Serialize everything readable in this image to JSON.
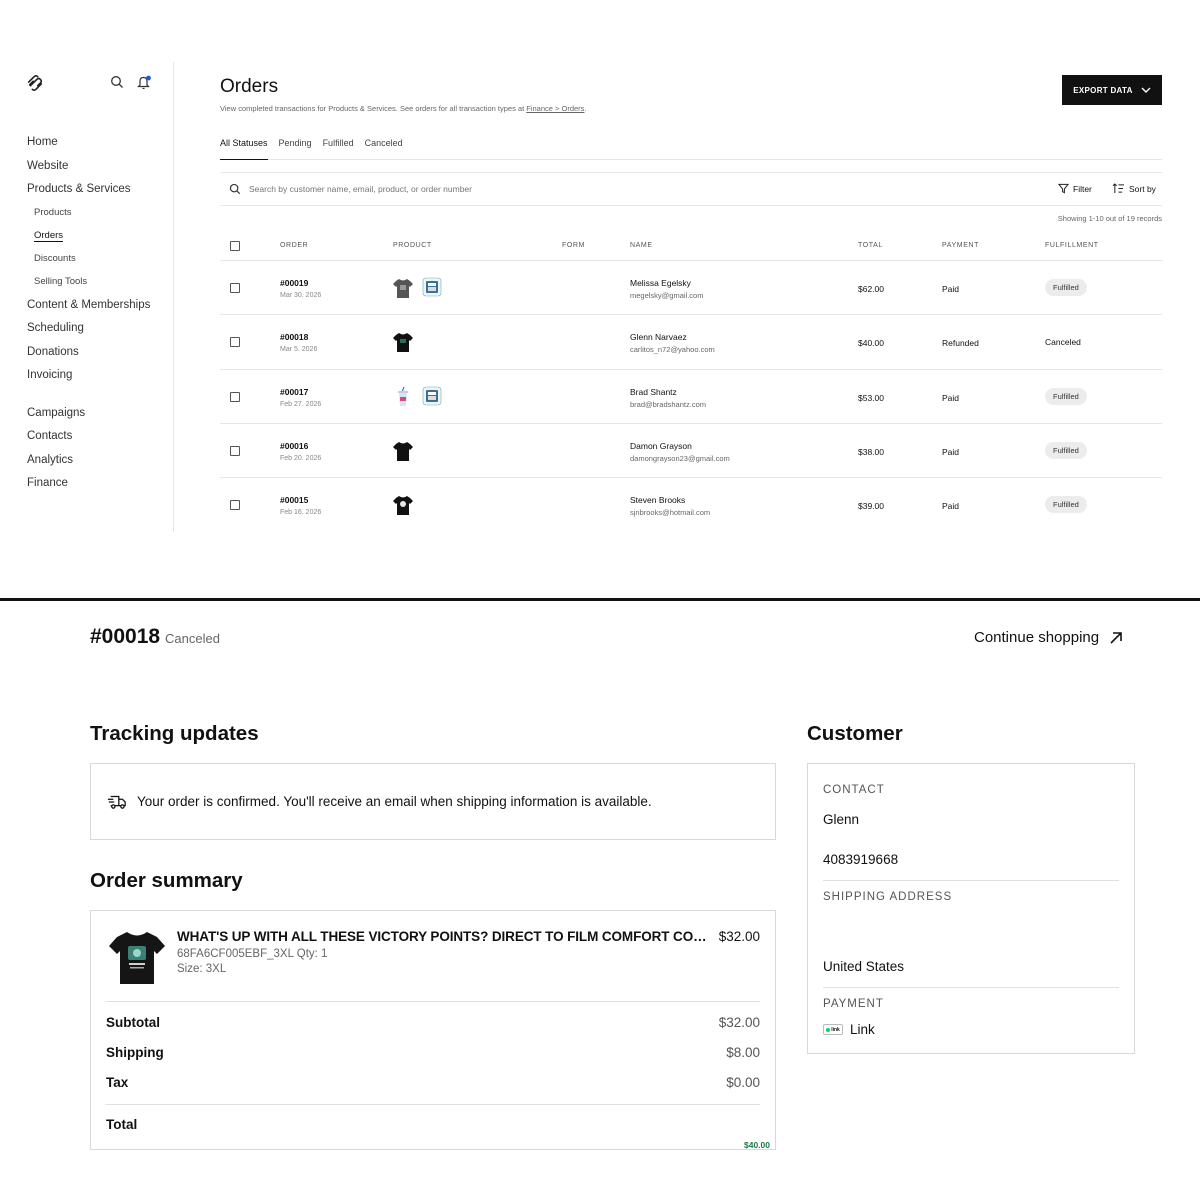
{
  "sidebar": {
    "nav": [
      {
        "label": "Home",
        "level": 1
      },
      {
        "label": "Website",
        "level": 1
      },
      {
        "label": "Products & Services",
        "level": 1
      },
      {
        "label": "Products",
        "level": 2
      },
      {
        "label": "Orders",
        "level": 2,
        "active": true
      },
      {
        "label": "Discounts",
        "level": 2
      },
      {
        "label": "Selling Tools",
        "level": 2
      },
      {
        "label": "Content & Memberships",
        "level": 1
      },
      {
        "label": "Scheduling",
        "level": 1
      },
      {
        "label": "Donations",
        "level": 1
      },
      {
        "label": "Invoicing",
        "level": 1
      },
      {
        "label": "Campaigns",
        "level": 1,
        "gap": true
      },
      {
        "label": "Contacts",
        "level": 1
      },
      {
        "label": "Analytics",
        "level": 1
      },
      {
        "label": "Finance",
        "level": 1
      }
    ]
  },
  "orders_page": {
    "title": "Orders",
    "description": "View completed transactions for Products & Services. See orders for all transaction types at ",
    "description_link": "Finance > Orders",
    "description_end": ".",
    "export_label": "EXPORT DATA",
    "tabs": [
      "All Statuses",
      "Pending",
      "Fulfilled",
      "Canceled"
    ],
    "active_tab": "All Statuses",
    "search_placeholder": "Search by customer name, email, product, or order number",
    "filter_label": "Filter",
    "sort_label": "Sort by",
    "records_text": "Showing 1-10 out of 19 records",
    "columns": [
      "ORDER",
      "PRODUCT",
      "FORM",
      "NAME",
      "TOTAL",
      "PAYMENT",
      "FULFILLMENT"
    ],
    "rows": [
      {
        "order": "#00019",
        "date": "Mar 30, 2026",
        "products": [
          "tshirt-gray",
          "sticker"
        ],
        "name": "Melissa Egelsky",
        "email": "megelsky@gmail.com",
        "total": "$62.00",
        "payment": "Paid",
        "fulfillment": "Fulfilled",
        "pill": true
      },
      {
        "order": "#00018",
        "date": "Mar 5, 2026",
        "products": [
          "tshirt-black"
        ],
        "name": "Glenn Narvaez",
        "email": "carlitos_n72@yahoo.com",
        "total": "$40.00",
        "payment": "Refunded",
        "fulfillment": "Canceled",
        "pill": false
      },
      {
        "order": "#00017",
        "date": "Feb 27, 2026",
        "products": [
          "cup",
          "sticker"
        ],
        "name": "Brad Shantz",
        "email": "brad@bradshantz.com",
        "total": "$53.00",
        "payment": "Paid",
        "fulfillment": "Fulfilled",
        "pill": true
      },
      {
        "order": "#00016",
        "date": "Feb 20, 2026",
        "products": [
          "tshirt-black"
        ],
        "name": "Damon Grayson",
        "email": "damongrayson23@gmail.com",
        "total": "$38.00",
        "payment": "Paid",
        "fulfillment": "Fulfilled",
        "pill": true
      },
      {
        "order": "#00015",
        "date": "Feb 16, 2026",
        "products": [
          "tshirt-black-graphic"
        ],
        "name": "Steven Brooks",
        "email": "sjnbrooks@hotmail.com",
        "total": "$39.00",
        "payment": "Paid",
        "fulfillment": "Fulfilled",
        "pill": true
      }
    ]
  },
  "order_detail": {
    "order_id": "#00018",
    "status": "Canceled",
    "continue_label": "Continue shopping",
    "tracking_heading": "Tracking updates",
    "tracking_message": "Your order is confirmed. You'll receive an email when shipping information is available.",
    "summary_heading": "Order summary",
    "item": {
      "title": "WHAT'S UP WITH ALL THESE VICTORY POINTS? DIRECT TO FILM COMFORT COLORS T-SHIRT",
      "price": "$32.00",
      "sku_line": "68FA6CF005EBF_3XL Qty: 1",
      "size_line": "Size: 3XL"
    },
    "totals": [
      {
        "label": "Subtotal",
        "value": "$32.00"
      },
      {
        "label": "Shipping",
        "value": "$8.00"
      },
      {
        "label": "Tax",
        "value": "$0.00"
      }
    ],
    "total_label": "Total",
    "total_value": "$40.00",
    "customer_heading": "Customer",
    "contact_label": "CONTACT",
    "contact_name": "Glenn",
    "contact_phone": "4083919668",
    "shipping_label": "SHIPPING ADDRESS",
    "shipping_country": "United States",
    "payment_label": "PAYMENT",
    "payment_method": "Link",
    "payment_badge": "link"
  },
  "colors": {
    "accent_total": "#1a7a48",
    "notification_dot": "#1e5bd6",
    "button_bg": "#111111"
  }
}
